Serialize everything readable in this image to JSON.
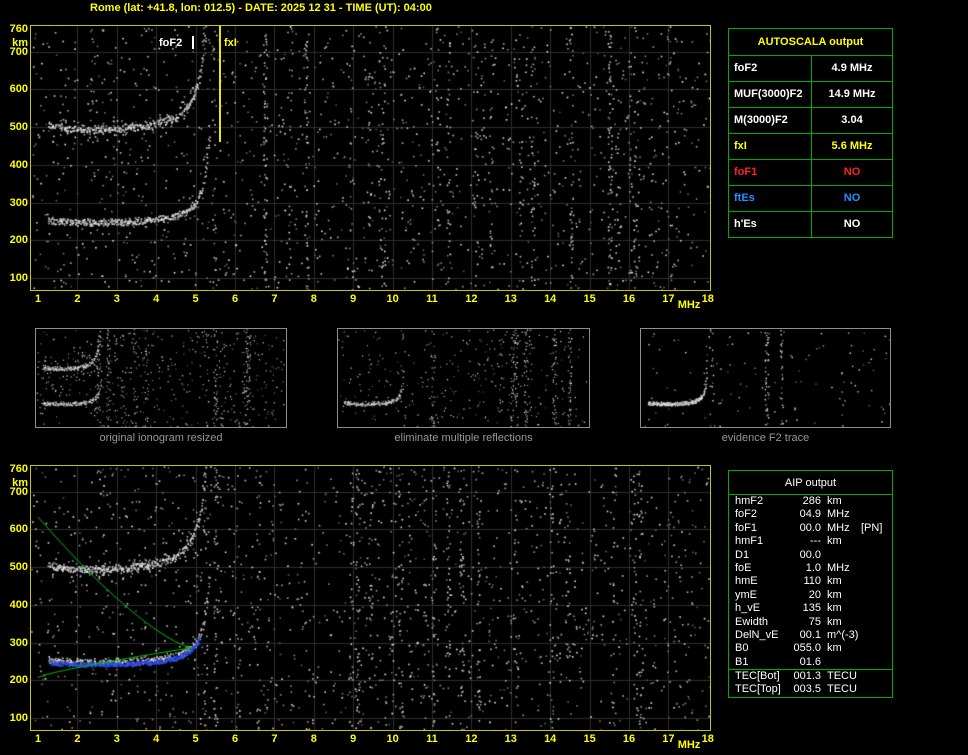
{
  "title": "Rome (lat: +41.8, lon: 012.5) - DATE: 2025 12 31 - TIME (UT): 04:00",
  "colors": {
    "background": "#000000",
    "accent_yellow": "#ffff00",
    "plot_border": "#c6c600",
    "table_border": "#00aa00",
    "status_no_red": "#ff2020",
    "status_no_blue": "#2090ff",
    "profile_green": "#00c400",
    "restored_trace_blue": "#3355ee",
    "caption_gray": "#989898"
  },
  "autoscala": {
    "header": "AUTOSCALA output",
    "rows": [
      {
        "param": "foF2",
        "value": "4.9 MHz",
        "color": "#ffffff"
      },
      {
        "param": "MUF(3000)F2",
        "value": "14.9 MHz",
        "color": "#ffffff"
      },
      {
        "param": "M(3000)F2",
        "value": "3.04",
        "color": "#ffffff"
      },
      {
        "param": "fxI",
        "value": "5.6 MHz",
        "color": "#ffff00"
      },
      {
        "param": "foF1",
        "value": "NO",
        "color": "#ff2020"
      },
      {
        "param": "ftEs",
        "value": "NO",
        "color": "#2090ff"
      },
      {
        "param": "h'Es",
        "value": "NO",
        "color": "#ffffff"
      }
    ]
  },
  "aip": {
    "header": "AIP output",
    "rows": [
      {
        "param": "hmF2",
        "value": "286",
        "unit": "km",
        "note": ""
      },
      {
        "param": "foF2",
        "value": "04.9",
        "unit": "MHz",
        "note": ""
      },
      {
        "param": "foF1",
        "value": "00.0",
        "unit": "MHz",
        "note": "[PN]"
      },
      {
        "param": "hmF1",
        "value": "---",
        "unit": "km",
        "note": ""
      },
      {
        "param": "D1",
        "value": "00.0",
        "unit": "",
        "note": ""
      },
      {
        "param": "foE",
        "value": "1.0",
        "unit": "MHz",
        "note": ""
      },
      {
        "param": "hmE",
        "value": "110",
        "unit": "km",
        "note": ""
      },
      {
        "param": "ymE",
        "value": "20",
        "unit": "km",
        "note": ""
      },
      {
        "param": "h_vE",
        "value": "135",
        "unit": "km",
        "note": ""
      },
      {
        "param": "Ewidth",
        "value": "75",
        "unit": "km",
        "note": ""
      },
      {
        "param": "DelN_vE",
        "value": "00.1",
        "unit": "m^(-3)",
        "note": ""
      },
      {
        "param": "B0",
        "value": "055.0",
        "unit": "km",
        "note": ""
      },
      {
        "param": "B1",
        "value": "01.6",
        "unit": "",
        "note": ""
      },
      {
        "param": "TEC[Bot]",
        "value": "001.3",
        "unit": "TECU",
        "note": "",
        "sep": true
      },
      {
        "param": "TEC[Top]",
        "value": "003.5",
        "unit": "TECU",
        "note": ""
      }
    ]
  },
  "thumbnails": [
    {
      "caption": "original ionogram resized"
    },
    {
      "caption": "eliminate multiple reflections"
    },
    {
      "caption": "evidence F2 trace"
    }
  ],
  "chart_data": [
    {
      "type": "scatter",
      "title": "ionogram with AUTOSCALA interpretation (top panel)",
      "xlabel": "MHz",
      "ylabel": "km",
      "xlim": [
        1,
        18
      ],
      "ylim": [
        100,
        760
      ],
      "grid": true,
      "x_ticks": [
        1,
        2,
        3,
        4,
        5,
        6,
        7,
        8,
        9,
        10,
        11,
        12,
        13,
        14,
        15,
        16,
        17,
        18
      ],
      "y_ticks": [
        760,
        700,
        600,
        500,
        400,
        300,
        200,
        100
      ],
      "annotations": [
        {
          "label": "foF2",
          "freq_mhz": 4.9,
          "color": "#ffffff"
        },
        {
          "label": "fxI",
          "freq_mhz": 5.6,
          "color": "#ffff00"
        }
      ],
      "series": [
        {
          "name": "F2-layer first-hop echo trace (white dots)",
          "points_approx": [
            [
              1.3,
              253
            ],
            [
              2,
              248
            ],
            [
              3,
              248
            ],
            [
              4,
              255
            ],
            [
              4.5,
              265
            ],
            [
              5,
              301
            ],
            [
              5.2,
              355
            ],
            [
              5.3,
              430
            ],
            [
              5.4,
              510
            ]
          ]
        },
        {
          "name": "F2-layer second-hop echo trace (white dots)",
          "points_approx": [
            [
              1.3,
              506
            ],
            [
              2,
              496
            ],
            [
              3,
              496
            ],
            [
              4,
              510
            ],
            [
              4.7,
              560
            ],
            [
              5,
              602
            ],
            [
              5.2,
              710
            ],
            [
              5.25,
              760
            ]
          ]
        },
        {
          "name": "background noise (scattered white speckle over full frequency range)",
          "points_approx": []
        }
      ],
      "trace_model": {
        "h0": 235,
        "a": 18,
        "p1": 1.5,
        "b": 28,
        "fc": 5.5,
        "p2": 1.2,
        "fmin": 1.25,
        "fmax": 5.42,
        "cap_hop1_km": 515,
        "cap_hop2_km": 775
      }
    },
    {
      "type": "scatter",
      "title": "ionogram with restored trace and electron density profile (bottom panel)",
      "xlabel": "MHz",
      "ylabel": "km",
      "xlim": [
        1,
        18
      ],
      "ylim": [
        100,
        760
      ],
      "grid": true,
      "x_ticks": [
        1,
        2,
        3,
        4,
        5,
        6,
        7,
        8,
        9,
        10,
        11,
        12,
        13,
        14,
        15,
        16,
        17,
        18
      ],
      "y_ticks": [
        760,
        700,
        600,
        500,
        400,
        300,
        200,
        100
      ],
      "series": [
        {
          "name": "F2-layer first-hop echo trace (white dots)",
          "points_approx": [
            [
              1.3,
              253
            ],
            [
              2,
              248
            ],
            [
              3,
              248
            ],
            [
              4,
              255
            ],
            [
              4.5,
              265
            ],
            [
              5,
              301
            ],
            [
              5.3,
              430
            ],
            [
              5.4,
              510
            ]
          ]
        },
        {
          "name": "F2-layer second-hop echo trace (white dots)",
          "points_approx": [
            [
              1.3,
              506
            ],
            [
              2,
              496
            ],
            [
              3,
              496
            ],
            [
              4,
              510
            ],
            [
              5,
              602
            ],
            [
              5.25,
              760
            ]
          ]
        },
        {
          "name": "restored F2 trace (blue dots)",
          "points_approx": [
            [
              1.4,
              250
            ],
            [
              2,
              245
            ],
            [
              3,
              245
            ],
            [
              4,
              252
            ],
            [
              4.5,
              262
            ],
            [
              5,
              298
            ]
          ]
        },
        {
          "name": "electron density profile N(h) (green line, topside then bottomside)",
          "points_approx": [
            [
              1,
              633
            ],
            [
              2,
              518
            ],
            [
              3,
              417
            ],
            [
              4,
              333
            ],
            [
              4.9,
              286
            ],
            [
              3,
              246
            ],
            [
              2,
              233
            ],
            [
              1,
              207
            ]
          ]
        }
      ],
      "profile_model": {
        "peak_f": 4.9,
        "peak_h": 286,
        "top_h": 633,
        "bot_h": 207,
        "top_p": 1.35,
        "bot_p": 0.8
      }
    }
  ]
}
